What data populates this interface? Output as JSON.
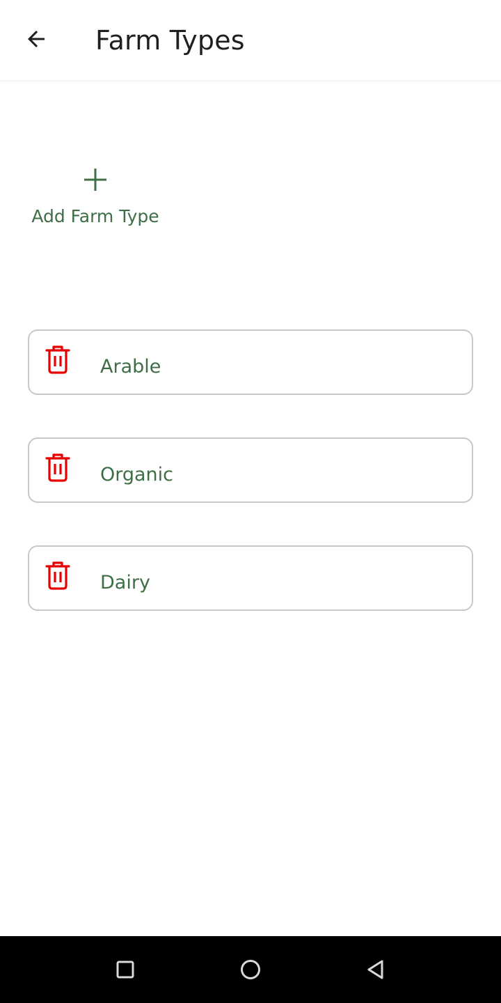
{
  "header": {
    "title": "Farm Types",
    "back_icon": "arrow-left-icon"
  },
  "add": {
    "label": "Add Farm Type",
    "icon": "plus-icon"
  },
  "farm_types": [
    {
      "name": "Arable",
      "icon": "trash-icon"
    },
    {
      "name": "Organic",
      "icon": "trash-icon"
    },
    {
      "name": "Dairy",
      "icon": "trash-icon"
    }
  ],
  "system_nav": {
    "buttons": [
      "recent-apps-icon",
      "home-icon",
      "back-triangle-icon"
    ]
  },
  "colors": {
    "accent_green": "#3d6e45",
    "delete_red": "#e60000",
    "card_border": "#c8c8c8",
    "nav_background": "#000000"
  }
}
